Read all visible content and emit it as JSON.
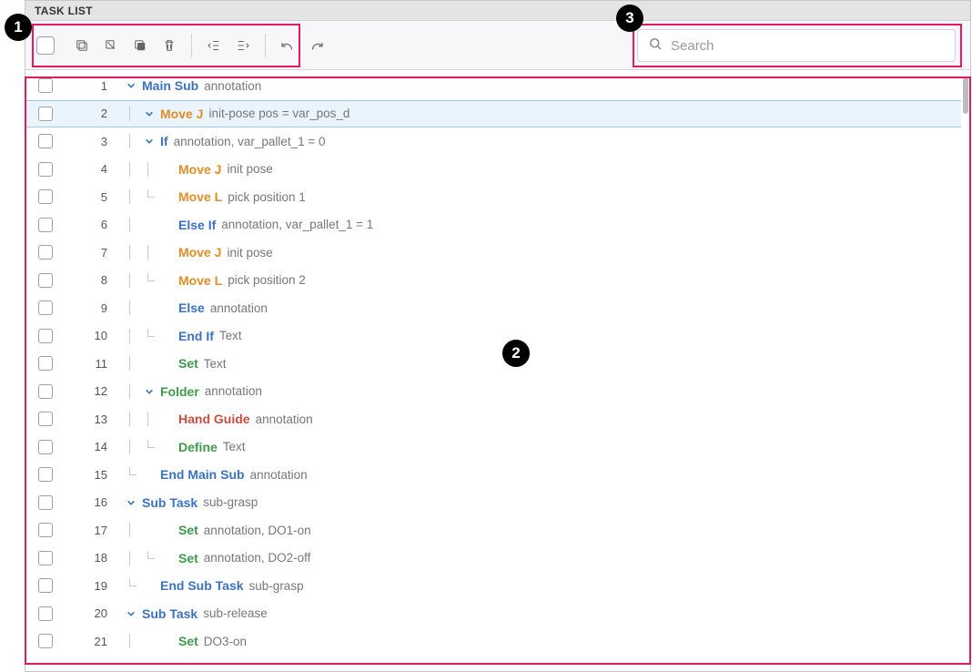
{
  "header": {
    "title": "TASK LIST"
  },
  "search": {
    "placeholder": "Search",
    "value": ""
  },
  "callouts": {
    "one": "1",
    "two": "2",
    "three": "3"
  },
  "rows": [
    {
      "n": 1,
      "indent": 0,
      "chev": "down",
      "cmd": "Main Sub",
      "color": "blue",
      "ann": "annotation"
    },
    {
      "n": 2,
      "indent": 1,
      "chev": "down",
      "cmd": "Move J",
      "color": "orange",
      "ann": "init-pose  pos = var_pos_d",
      "selected": true
    },
    {
      "n": 3,
      "indent": 1,
      "chev": "down",
      "cmd": "If",
      "color": "blue",
      "ann": "annotation,  var_pallet_1 = 0"
    },
    {
      "n": 4,
      "indent": 2,
      "chev": null,
      "cmd": "Move J",
      "color": "orange",
      "ann": "init pose"
    },
    {
      "n": 5,
      "indent": 2,
      "chev": null,
      "cmd": "Move L",
      "color": "orange",
      "ann": "pick position 1",
      "elbow": true
    },
    {
      "n": 6,
      "indent": 2,
      "chev": null,
      "cmd": "Else If",
      "color": "blue",
      "ann": "annotation,  var_pallet_1 = 1",
      "outdent_one": true
    },
    {
      "n": 7,
      "indent": 2,
      "chev": null,
      "cmd": "Move J",
      "color": "orange",
      "ann": "init pose"
    },
    {
      "n": 8,
      "indent": 2,
      "chev": null,
      "cmd": "Move L",
      "color": "orange",
      "ann": "pick position 2",
      "elbow": true
    },
    {
      "n": 9,
      "indent": 2,
      "chev": null,
      "cmd": "Else",
      "color": "blue",
      "ann": "annotation",
      "outdent_one": true
    },
    {
      "n": 10,
      "indent": 2,
      "chev": null,
      "cmd": "End If",
      "color": "blue",
      "ann": "Text",
      "outdent_one": true,
      "elbow_outer": true
    },
    {
      "n": 11,
      "indent": 2,
      "chev": null,
      "cmd": "Set",
      "color": "green",
      "ann": "Text",
      "outdent_one": true
    },
    {
      "n": 12,
      "indent": 1,
      "chev": "down",
      "cmd": "Folder",
      "color": "green",
      "ann": "annotation"
    },
    {
      "n": 13,
      "indent": 2,
      "chev": null,
      "cmd": "Hand Guide",
      "color": "red",
      "ann": "annotation"
    },
    {
      "n": 14,
      "indent": 2,
      "chev": null,
      "cmd": "Define",
      "color": "green",
      "ann": "Text",
      "elbow": true
    },
    {
      "n": 15,
      "indent": 1,
      "chev": null,
      "cmd": "End Main Sub",
      "color": "blue",
      "ann": "annotation",
      "outdent_one": true,
      "elbow_outer": true
    },
    {
      "n": 16,
      "indent": 0,
      "chev": "down",
      "cmd": "Sub Task",
      "color": "blue",
      "ann": "sub-grasp"
    },
    {
      "n": 17,
      "indent": 2,
      "chev": null,
      "cmd": "Set",
      "color": "green",
      "ann": "annotation,  DO1-on",
      "outdent_one": true
    },
    {
      "n": 18,
      "indent": 2,
      "chev": null,
      "cmd": "Set",
      "color": "green",
      "ann": "annotation,  DO2-off",
      "outdent_one": true,
      "elbow_outer": true
    },
    {
      "n": 19,
      "indent": 1,
      "chev": null,
      "cmd": "End Sub Task",
      "color": "blue",
      "ann": "sub-grasp",
      "outdent_one": true,
      "elbow_outer": true
    },
    {
      "n": 20,
      "indent": 0,
      "chev": "down",
      "cmd": "Sub Task",
      "color": "blue",
      "ann": "sub-release"
    },
    {
      "n": 21,
      "indent": 2,
      "chev": null,
      "cmd": "Set",
      "color": "green",
      "ann": "DO3-on",
      "outdent_one": true
    }
  ]
}
